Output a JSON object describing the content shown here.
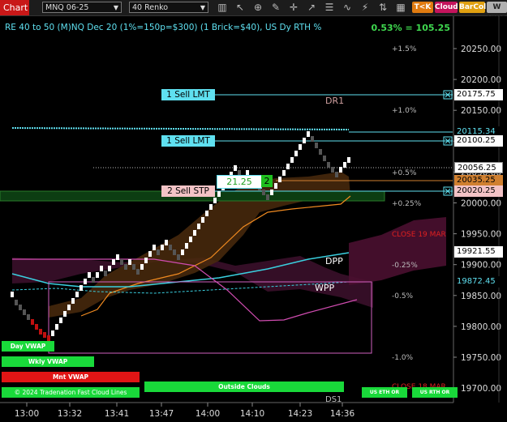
{
  "toolbar": {
    "app_label": "Chart",
    "instrument": "MNQ 06-25",
    "bar_type": "40 Renko",
    "buttons": [
      "T<K",
      "Cloud",
      "BarCol",
      "W VWA"
    ]
  },
  "chart_header": {
    "title": "RE 40 to 50 (M)NQ Dec 20 (1%=150p=$300) (1 Brick=$40), US Dy RTH %",
    "stat": "0.53% = 105.25"
  },
  "price_axis": {
    "ticks": [
      "20250.00",
      "20200.00",
      "20150.00",
      "20100.00",
      "20050.00",
      "20000.00",
      "19950.00",
      "19900.00",
      "19850.00",
      "19800.00",
      "19750.00",
      "19700.00"
    ],
    "markers": [
      {
        "text": "20175.75",
        "price": 20175.75
      },
      {
        "text": "20115.34",
        "price": 20115.34
      },
      {
        "text": "20100.25",
        "price": 20100.25
      },
      {
        "text": "20056.25",
        "price": 20056.25
      },
      {
        "text": "20035.25",
        "price": 20035.25
      },
      {
        "text": "20020.25",
        "price": 20020.25
      },
      {
        "text": "19921.55",
        "price": 19921.55
      },
      {
        "text": "19872.45",
        "price": 19872.45
      }
    ]
  },
  "time_axis": {
    "ticks": [
      "13:00",
      "13:32",
      "13:41",
      "13:47",
      "14:00",
      "14:10",
      "14:23",
      "14:36"
    ]
  },
  "orders": [
    {
      "label": "1 Sell LMT",
      "price": 20175.75
    },
    {
      "label": "1 Sell LMT",
      "price": 20100.25
    },
    {
      "label": "2 Sell STP",
      "price": 20020.25
    }
  ],
  "position": {
    "price": "21.25",
    "qty": "2"
  },
  "levels": {
    "plus_1_5": "+1.5%",
    "plus_1_0": "+1.0%",
    "plus_0_5": "+0.5%",
    "plus_0_25": "+0.25%",
    "minus_0_25": "-0.25%",
    "minus_0_5": "-0.5%",
    "minus_1_0": "-1.0%",
    "dr1": "DR1",
    "dpp": "DPP",
    "wpp": "WPP",
    "close_19_mar": "CLOSE 19 MAR",
    "close_18_mar": "CLOSE 18 MAR",
    "ds1": "DS1"
  },
  "bottom_buttons": {
    "day_vwap": "Day VWAP",
    "wkly_vwap": "Wkly VWAP",
    "mnt_vwap": "Mnt VWAP",
    "copyright": "© 2024 Tradenation Fast Cloud Lines",
    "outside_clouds": "Outside Clouds",
    "us_eth_or": "US ETH OR",
    "us_rth_or": "US RTH OR"
  },
  "colors": {
    "accent_cyan": "#5fe0f0",
    "up_brick": "#ffffff",
    "down_brick": "#555555",
    "stat_green": "#3fd84f",
    "vwap_green": "#19d93a",
    "vwap_red": "#e01515"
  }
}
